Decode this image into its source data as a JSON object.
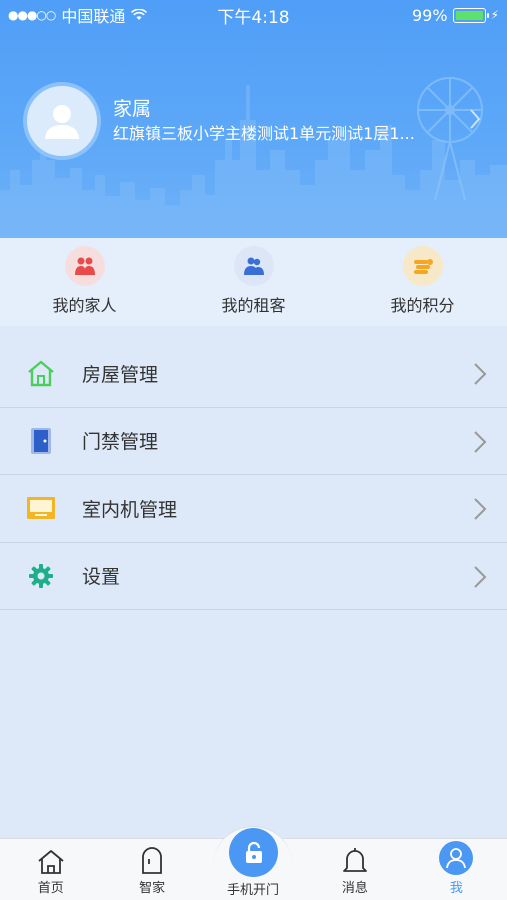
{
  "status_bar": {
    "carrier": "中国联通",
    "time": "下午4:18",
    "battery": "99%"
  },
  "profile": {
    "name": "家属",
    "address": "红旗镇三板小学主楼测试1单元测试1层1..."
  },
  "quick_actions": [
    {
      "label": "我的家人",
      "icon": "family-icon",
      "color": "#e94a4a"
    },
    {
      "label": "我的租客",
      "icon": "tenant-icon",
      "color": "#3a6fd6"
    },
    {
      "label": "我的积分",
      "icon": "points-icon",
      "color": "#f5a623"
    }
  ],
  "menu": [
    {
      "label": "房屋管理",
      "icon": "house-icon"
    },
    {
      "label": "门禁管理",
      "icon": "door-icon"
    },
    {
      "label": "室内机管理",
      "icon": "indoor-unit-icon"
    },
    {
      "label": "设置",
      "icon": "settings-gear-icon"
    }
  ],
  "tabs": [
    {
      "label": "首页",
      "icon": "home-icon"
    },
    {
      "label": "智家",
      "icon": "smart-home-icon"
    },
    {
      "label": "手机开门",
      "icon": "unlock-icon"
    },
    {
      "label": "消息",
      "icon": "bell-icon"
    },
    {
      "label": "我",
      "icon": "user-icon",
      "active": true
    }
  ],
  "colors": {
    "header_blue": "#4f9ef7",
    "accent": "#4a98f3",
    "background": "#dde9f8"
  }
}
